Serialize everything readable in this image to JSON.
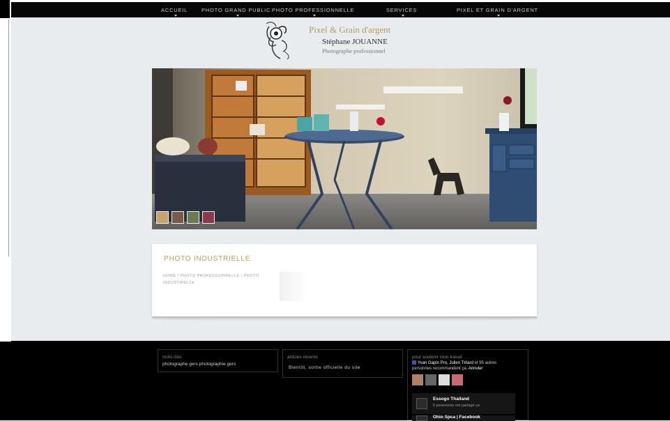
{
  "nav": {
    "items": [
      {
        "label": "ACCUEIL",
        "has_dropdown": true
      },
      {
        "label": "PHOTO GRAND PUBLIC",
        "has_dropdown": true
      },
      {
        "label": "PHOTO PROFESSIONNELLE",
        "has_dropdown": true
      },
      {
        "label": "SERVICES",
        "has_dropdown": true
      },
      {
        "label": "PIXEL ET GRAIN D'ARGENT",
        "has_dropdown": true
      }
    ]
  },
  "brand": {
    "title": "Pixel & Grain d'argent",
    "name": "Stéphane JOUANNE",
    "subtitle": "Photographe professionnel"
  },
  "page": {
    "heading": "PHOTO INDUSTRIELLE",
    "breadcrumb": "HOME / PHOTO PROFESSIONNELLE / PHOTO INDUSTRIELLE"
  },
  "footer": {
    "tags": {
      "title": "mots clés",
      "value": "photographe gers photographie gers"
    },
    "recent": {
      "title": "articles récents",
      "value": "Bientôt, sortie officielle du site"
    },
    "facebook": {
      "title": "pour soutenir mon travail",
      "names": "Yvan Gapin Pro, Julien Tétard",
      "rest": "et 95 autres personnes recommandent ça.",
      "cancel": "Annuler",
      "posts": [
        {
          "title": "Essogo Thailand",
          "subtitle": "6 personnes ont partagé ça."
        },
        {
          "title": "Ohio Spca | Facebook",
          "subtitle": ""
        }
      ]
    }
  },
  "colors": {
    "accent": "#c49a58",
    "nav_bg": "#070707",
    "footer_bg": "#000000",
    "page_bg": "#e9ecef"
  }
}
